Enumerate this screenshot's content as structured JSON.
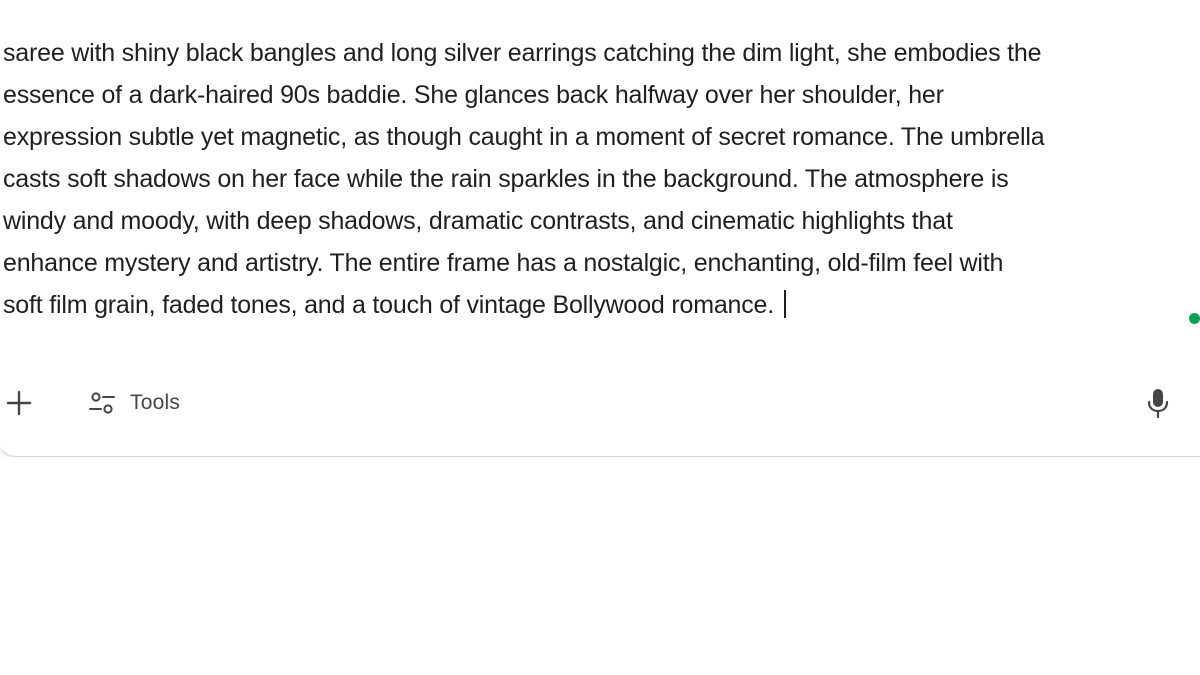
{
  "prompt": {
    "lines": [
      "saree with shiny black bangles and long silver earrings catching the dim light, she embodies the",
      "essence of a dark-haired 90s baddie. She glances back halfway over her shoulder, her",
      "expression subtle yet magnetic, as though caught in a moment of secret romance. The umbrella",
      "casts soft shadows on her face while the rain sparkles in the background. The atmosphere is",
      "windy and moody, with deep shadows, dramatic contrasts, and cinematic highlights that",
      "enhance mystery and artistry. The entire frame has a nostalgic, enchanting, old-film feel with",
      "soft film grain, faded tones, and a touch of vintage Bollywood romance."
    ]
  },
  "toolbar": {
    "add_icon": "plus-icon",
    "tools_icon": "tools-sliders-icon",
    "tools_label": "Tools",
    "mic_icon": "microphone-icon"
  },
  "colors": {
    "text": "#1f1f1f",
    "icon": "#444746",
    "status_dot": "#0f9d58",
    "card_border": "#d9d9dc",
    "background": "#ffffff"
  }
}
